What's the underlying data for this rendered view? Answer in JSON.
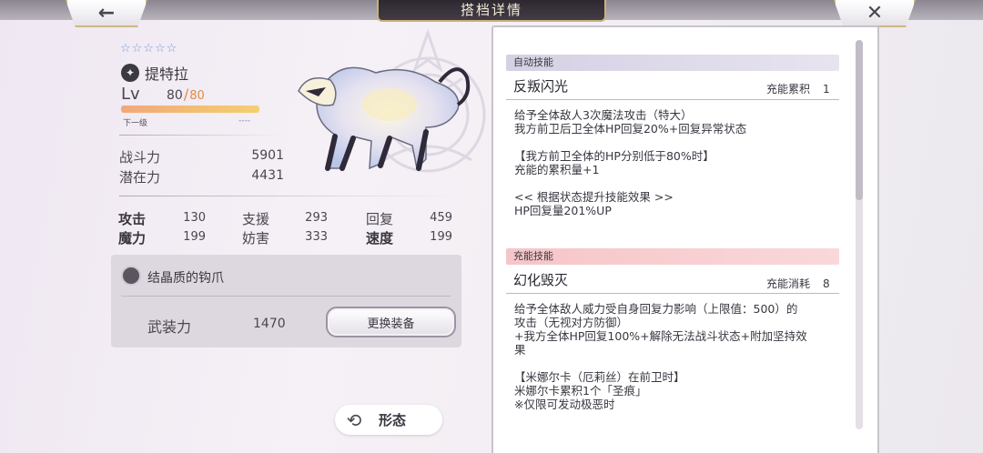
{
  "header": {
    "title": "搭档详情",
    "back_icon": "←",
    "close_icon": "✕"
  },
  "character": {
    "stars": "☆☆☆☆☆",
    "element_icon": "✦",
    "name": "提特拉",
    "lv_label": "Lv",
    "lv_current": "80",
    "lv_sep": "/",
    "lv_max": "80",
    "exp_progress": 1.0,
    "next_label": "下一级",
    "next_value": "----"
  },
  "power": {
    "combat_label": "战斗力",
    "combat_value": "5901",
    "potential_label": "潜在力",
    "potential_value": "4431"
  },
  "attributes": [
    {
      "label": "攻击",
      "value": "130"
    },
    {
      "label": "支援",
      "value": "293"
    },
    {
      "label": "回复",
      "value": "459"
    },
    {
      "label": "魔力",
      "value": "199"
    },
    {
      "label": "妨害",
      "value": "333"
    },
    {
      "label": "速度",
      "value": "199"
    }
  ],
  "equipment": {
    "name": "结晶质的钩爪",
    "armament_label": "武装力",
    "armament_value": "1470",
    "change_button": "更换装备"
  },
  "form_button": {
    "label": "形态",
    "icon": "⟲"
  },
  "skills": {
    "auto": {
      "section": "自动技能",
      "name": "反叛闪光",
      "meta_label": "充能累积",
      "meta_value": "1",
      "desc": [
        "给予全体敌人3次魔法攻击（特大）",
        "我方前卫后卫全体HP回复20%+回复异常状态",
        "",
        "【我方前卫全体的HP分别低于80%时】",
        "充能的累积量+1",
        "",
        "<< 根据状态提升技能效果 >>",
        "HP回复量201%UP"
      ]
    },
    "charge": {
      "section": "充能技能",
      "name": "幻化毁灭",
      "meta_label": "充能消耗",
      "meta_value": "8",
      "desc": [
        "给予全体敌人威力受自身回复力影响（上限值：500）的",
        "攻击（无视对方防御）",
        "+我方全体HP回复100%+解除无法战斗状态+附加坚持效",
        "果",
        "",
        "【米娜尔卡（厄莉丝）在前卫时】",
        "米娜尔卡累积1个「圣痕」",
        "※仅限可发动极恶时"
      ]
    }
  }
}
